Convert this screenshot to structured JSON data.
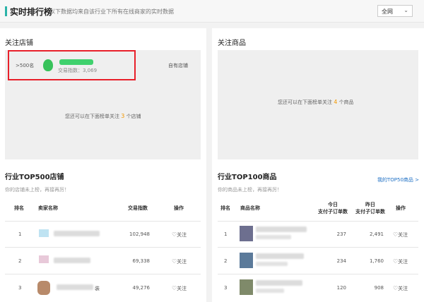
{
  "header": {
    "title": "实时排行榜",
    "description": "以下数据均来自该行业下所有在线商家的实时数据",
    "scope_select": "全网",
    "accent_color": "#2bb3a8"
  },
  "followed_stores": {
    "title": "关注店铺",
    "card": {
      "rank": ">500名",
      "trade_index": "交易指数：3,069",
      "tag": "自有店铺"
    },
    "tip_prefix": "您还可以在下面榜单关注",
    "tip_count": "3",
    "tip_suffix": "个店铺"
  },
  "followed_products": {
    "title": "关注商品",
    "tip_prefix": "您还可以在下面榜单关注",
    "tip_count": "4",
    "tip_suffix": "个商品"
  },
  "store_top500": {
    "title": "行业TOP500店铺",
    "subtitle": "你的店铺未上榜，再接再厉！",
    "columns": [
      "排名",
      "卖家名称",
      "交易指数",
      "操作"
    ],
    "rows": [
      {
        "rank": "1",
        "index": "102,948",
        "action": "关注",
        "thumb_color": "#bfe3f2"
      },
      {
        "rank": "2",
        "index": "69,338",
        "action": "关注",
        "thumb_color": "#e8c9d9"
      },
      {
        "rank": "3",
        "index": "49,276",
        "action": "关注",
        "thumb_color": "#b88a6a",
        "name_tail": "装"
      }
    ]
  },
  "product_top100": {
    "title": "行业TOP100商品",
    "subtitle": "你的商品未上榜，再接再厉！",
    "link": "我的TOP50商品 >",
    "columns": {
      "rank": "排名",
      "name": "商品名称",
      "today": [
        "今日",
        "支付子订单数"
      ],
      "yesterday": [
        "昨日",
        "支付子订单数"
      ],
      "action": "操作"
    },
    "rows": [
      {
        "rank": "1",
        "today": "237",
        "yesterday": "2,491",
        "action": "关注",
        "thumb_color": "#6d6f8f"
      },
      {
        "rank": "2",
        "today": "234",
        "yesterday": "1,760",
        "action": "关注",
        "thumb_color": "#5b7a9a"
      },
      {
        "rank": "3",
        "today": "120",
        "yesterday": "908",
        "action": "关注",
        "thumb_color": "#7f8a6a"
      }
    ]
  },
  "colors": {
    "highlight_number": "#f39800",
    "link": "#1d6fc4",
    "card_border": "#e8202a"
  }
}
